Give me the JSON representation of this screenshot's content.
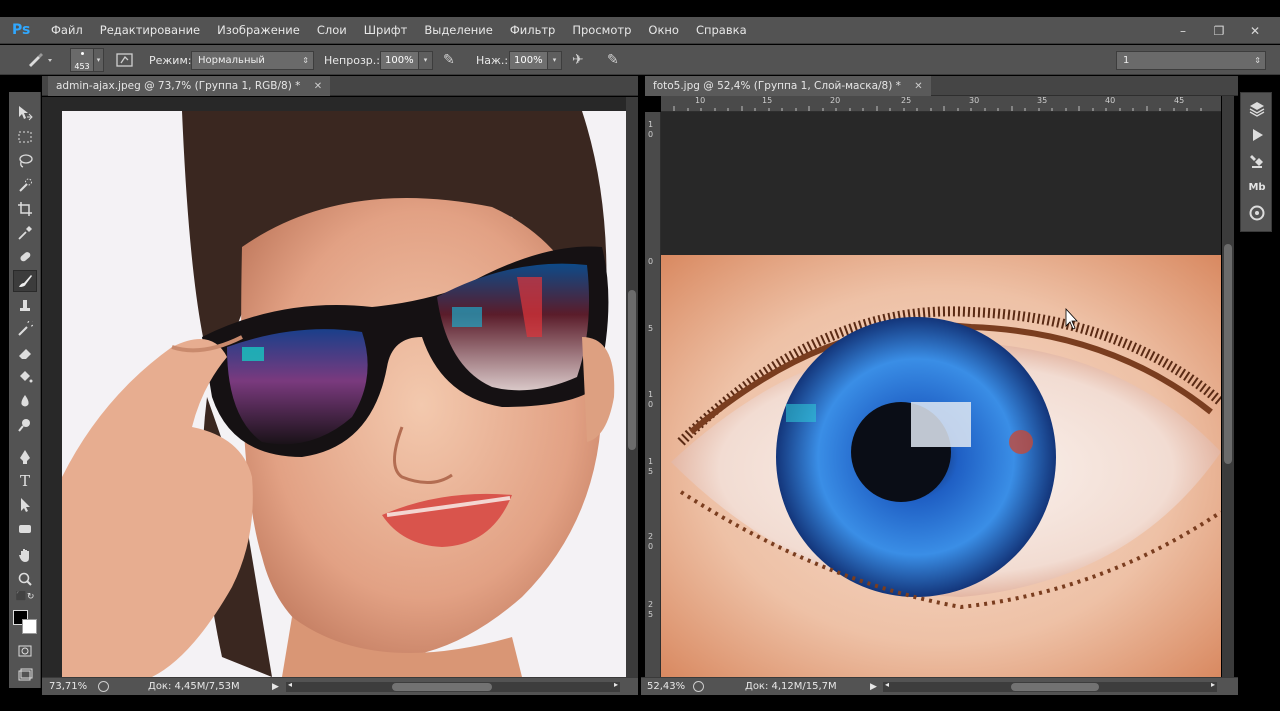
{
  "app": {
    "logo": "Ps",
    "logo_color": "#30a8ff"
  },
  "menu": [
    "Файл",
    "Редактирование",
    "Изображение",
    "Слои",
    "Шрифт",
    "Выделение",
    "Фильтр",
    "Просмотр",
    "Окно",
    "Справка"
  ],
  "window_controls": {
    "minimize": "–",
    "restore": "❐",
    "close": "✕"
  },
  "options": {
    "brush_size": "453",
    "mode_label": "Режим:",
    "mode_value": "Нормальный",
    "opacity_label": "Непрозр.:",
    "opacity_value": "100%",
    "flow_label": "Наж.:",
    "flow_value": "100%",
    "workspace_value": "1"
  },
  "documents": {
    "left": {
      "tab_title": "admin-ajax.jpeg @ 73,7% (Группа 1, RGB/8) *",
      "zoom": "73,71%",
      "doc_info": "Док: 4,45M/7,53M"
    },
    "right": {
      "tab_title": "foto5.jpg @ 52,4% (Группа 1, Слой-маска/8) *",
      "zoom": "52,43%",
      "doc_info": "Док: 4,12M/15,7M",
      "ruler_h": [
        "10",
        "15",
        "20",
        "25",
        "30",
        "35",
        "40",
        "45"
      ],
      "ruler_v": [
        "1",
        "0",
        "0",
        "5",
        "1",
        "0",
        "1",
        "5",
        "2",
        "0",
        "2",
        "5"
      ]
    }
  },
  "tools": [
    "move-tool",
    "marquee-tool",
    "lasso-tool",
    "quick-select-tool",
    "crop-tool",
    "eyedropper-tool",
    "healing-tool",
    "brush-tool",
    "stamp-tool",
    "history-brush-tool",
    "eraser-tool",
    "paint-bucket-tool",
    "blur-tool",
    "dodge-tool",
    "pen-tool",
    "type-tool",
    "path-select-tool",
    "shape-tool",
    "hand-tool",
    "zoom-tool"
  ],
  "colors": {
    "foreground": "#000000",
    "background": "#ffffff",
    "ui_bg": "#535353"
  },
  "dock_icons": [
    "layers-icon",
    "play-icon",
    "tool-presets-icon",
    "mini-bridge-icon",
    "cc-libraries-icon"
  ],
  "dock_labels": {
    "mb": "Mb"
  }
}
